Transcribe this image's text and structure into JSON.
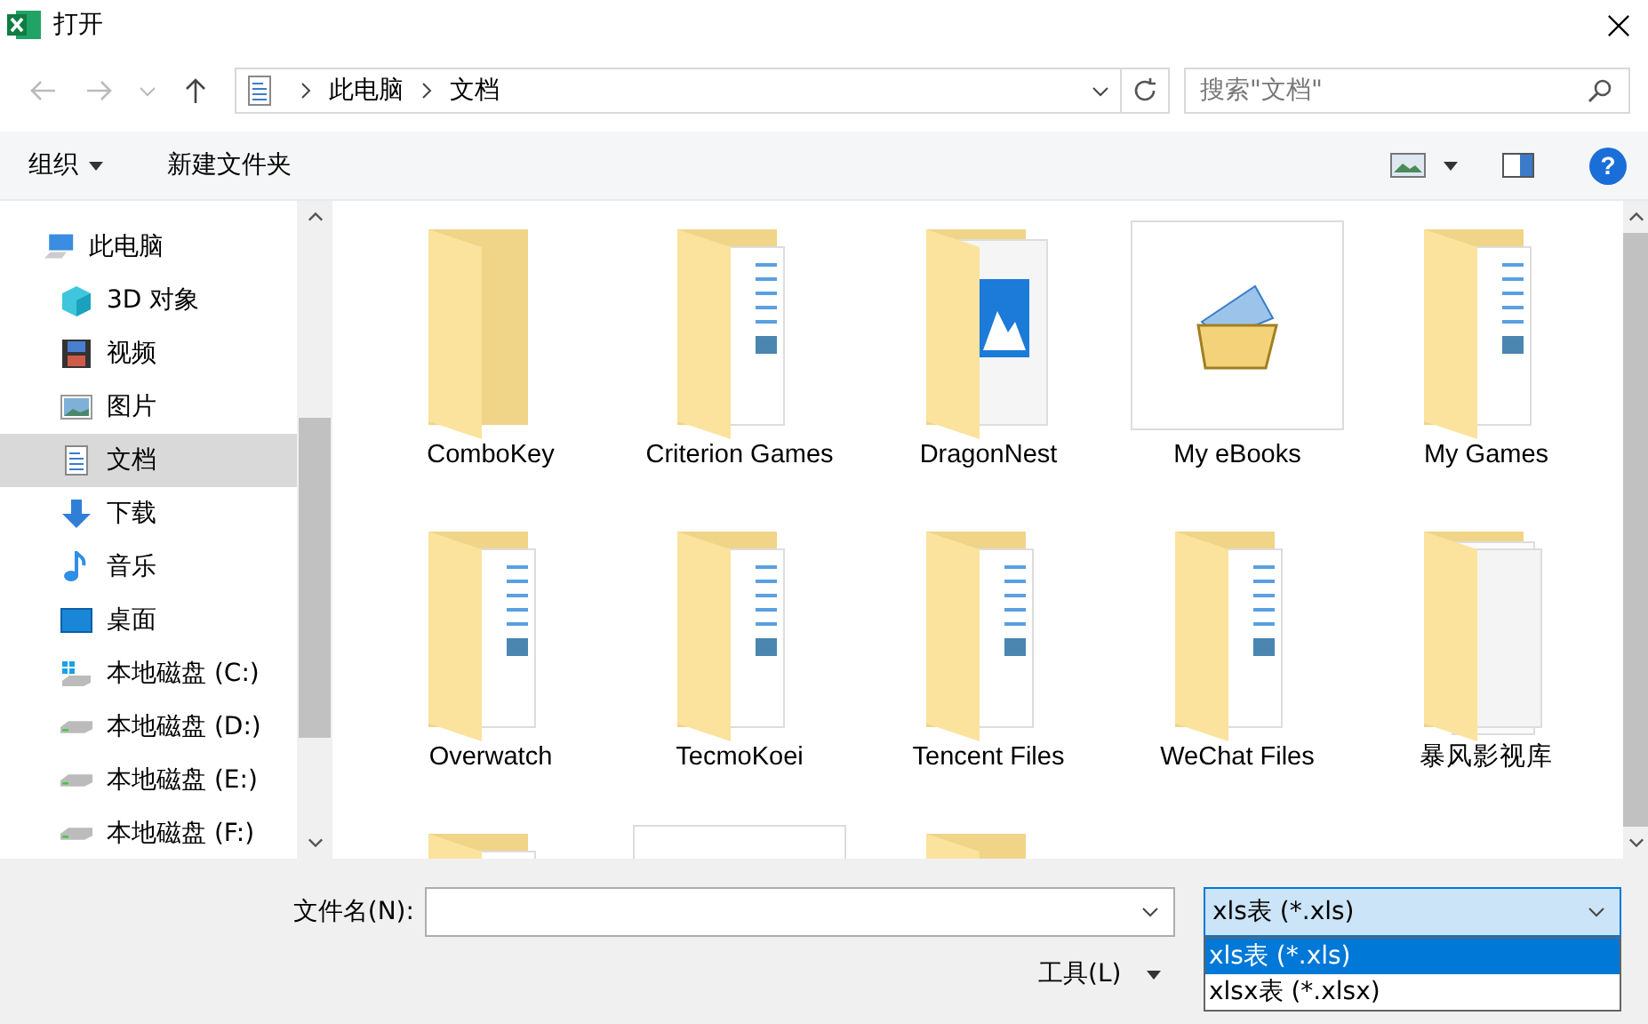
{
  "window": {
    "title": "打开"
  },
  "address": {
    "crumbs": [
      "此电脑",
      "文档"
    ],
    "search_placeholder": "搜索\"文档\""
  },
  "toolbar": {
    "organize": "组织",
    "new_folder": "新建文件夹",
    "help": "?"
  },
  "sidebar": {
    "items": [
      {
        "label": "此电脑",
        "kind": "pc",
        "selected": false
      },
      {
        "label": "3D 对象",
        "kind": "cube",
        "selected": false
      },
      {
        "label": "视频",
        "kind": "video",
        "selected": false
      },
      {
        "label": "图片",
        "kind": "picture",
        "selected": false
      },
      {
        "label": "文档",
        "kind": "document",
        "selected": true
      },
      {
        "label": "下载",
        "kind": "download",
        "selected": false
      },
      {
        "label": "音乐",
        "kind": "music",
        "selected": false
      },
      {
        "label": "桌面",
        "kind": "desktop",
        "selected": false
      },
      {
        "label": "本地磁盘 (C:)",
        "kind": "system-drive",
        "selected": false
      },
      {
        "label": "本地磁盘 (D:)",
        "kind": "drive",
        "selected": false
      },
      {
        "label": "本地磁盘 (E:)",
        "kind": "drive",
        "selected": false
      },
      {
        "label": "本地磁盘 (F:)",
        "kind": "drive",
        "selected": false
      }
    ]
  },
  "files": [
    {
      "label": "ComboKey",
      "kind": "folder"
    },
    {
      "label": "Criterion Games",
      "kind": "folder-docs"
    },
    {
      "label": "DragonNest",
      "kind": "folder-picture"
    },
    {
      "label": "My eBooks",
      "kind": "ebook"
    },
    {
      "label": "My Games",
      "kind": "folder-docs"
    },
    {
      "label": "Overwatch",
      "kind": "folder-docs"
    },
    {
      "label": "TecmoKoei",
      "kind": "folder-docs"
    },
    {
      "label": "Tencent Files",
      "kind": "folder-docs"
    },
    {
      "label": "WeChat Files",
      "kind": "folder-docs"
    },
    {
      "label": "暴风影视库",
      "kind": "folder-papers"
    },
    {
      "kind": "folder-grid"
    },
    {
      "kind": "program"
    },
    {
      "kind": "folder"
    }
  ],
  "bottom": {
    "filename_label": "文件名(N):",
    "filetype_value": "xls表 (*.xls)",
    "tools": "工具(L)",
    "filetype_options": [
      {
        "label": "xls表 (*.xls)",
        "selected": true
      },
      {
        "label": "xlsx表 (*.xlsx)",
        "selected": false
      }
    ]
  }
}
